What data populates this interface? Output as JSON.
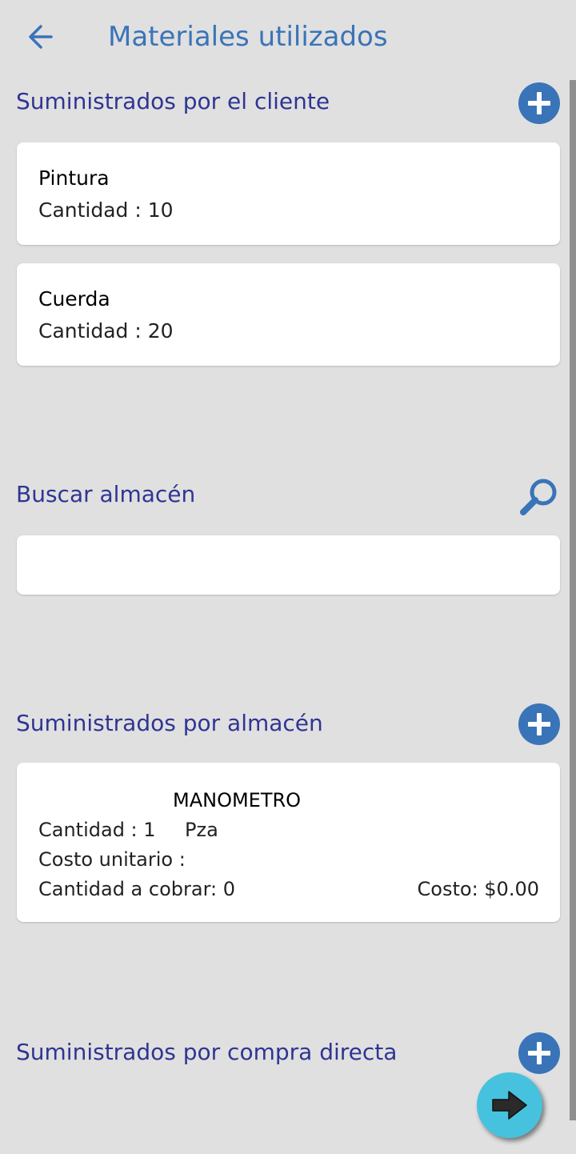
{
  "header": {
    "title": "Materiales utilizados",
    "back_icon": "arrow-left-icon"
  },
  "client_section": {
    "title": "Suministrados por el cliente",
    "add_icon": "plus-circle-icon",
    "items": [
      {
        "name": "Pintura",
        "quantity": "Cantidad : 10"
      },
      {
        "name": "Cuerda",
        "quantity": "Cantidad : 20"
      }
    ]
  },
  "search_section": {
    "title": "Buscar almacén",
    "search_icon": "magnifier-icon",
    "input_value": "",
    "placeholder": ""
  },
  "warehouse_section": {
    "title": "Suministrados por almacén",
    "add_icon": "plus-circle-icon",
    "item": {
      "name": "MANOMETRO",
      "quantity": "Cantidad : 1",
      "unit": "Pza",
      "unit_cost": "Costo unitario :",
      "charge_quantity": "Cantidad a cobrar: 0",
      "cost": "Costo: $0.00"
    }
  },
  "direct_purchase_section": {
    "title": "Suministrados por compra directa",
    "add_icon": "plus-circle-icon"
  },
  "fab": {
    "icon": "arrow-right-icon"
  },
  "colors": {
    "background": "#e0e0e0",
    "accent": "#3a74b8",
    "section_title": "#2f3592",
    "fab": "#47c2de"
  }
}
